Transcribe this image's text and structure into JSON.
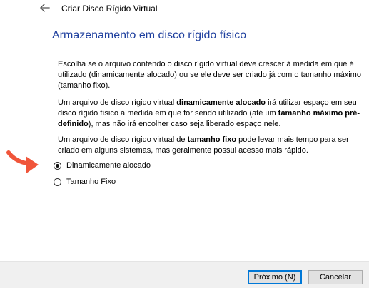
{
  "window": {
    "title": "Criar Disco Rígido Virtual"
  },
  "icons": {
    "back": "arrow-left-icon",
    "pointer": "red-arrow-icon"
  },
  "colors": {
    "heading": "#1e3f9e",
    "arrow": "#f0553a",
    "default_button_border": "#0078d7"
  },
  "main": {
    "heading": "Armazenamento em disco rígido físico",
    "p1": "Escolha se o arquivo contendo o disco rígido virtual deve crescer à medida em que é utilizado (dinamicamente alocado) ou se ele deve ser criado já com o tamanho máximo (tamanho fixo).",
    "p2": {
      "t1": "Um arquivo de disco rígido virtual ",
      "b1": "dinamicamente alocado",
      "t2": " irá utilizar espaço em seu disco rígido físico à medida em que for sendo utilizado (até um ",
      "b2": "tamanho máximo pré-definido",
      "t3": "), mas não irá encolher caso seja liberado espaço nele."
    },
    "p3": {
      "t1": "Um arquivo de disco rígido virtual de ",
      "b1": "tamanho fixo",
      "t2": " pode levar mais tempo para ser criado em alguns sistemas, mas geralmente possui acesso mais rápido."
    },
    "options": [
      {
        "label": "Dinamicamente alocado",
        "selected": true
      },
      {
        "label": "Tamanho Fixo",
        "selected": false
      }
    ]
  },
  "footer": {
    "next_label": "Próximo (N)",
    "cancel_label": "Cancelar"
  }
}
